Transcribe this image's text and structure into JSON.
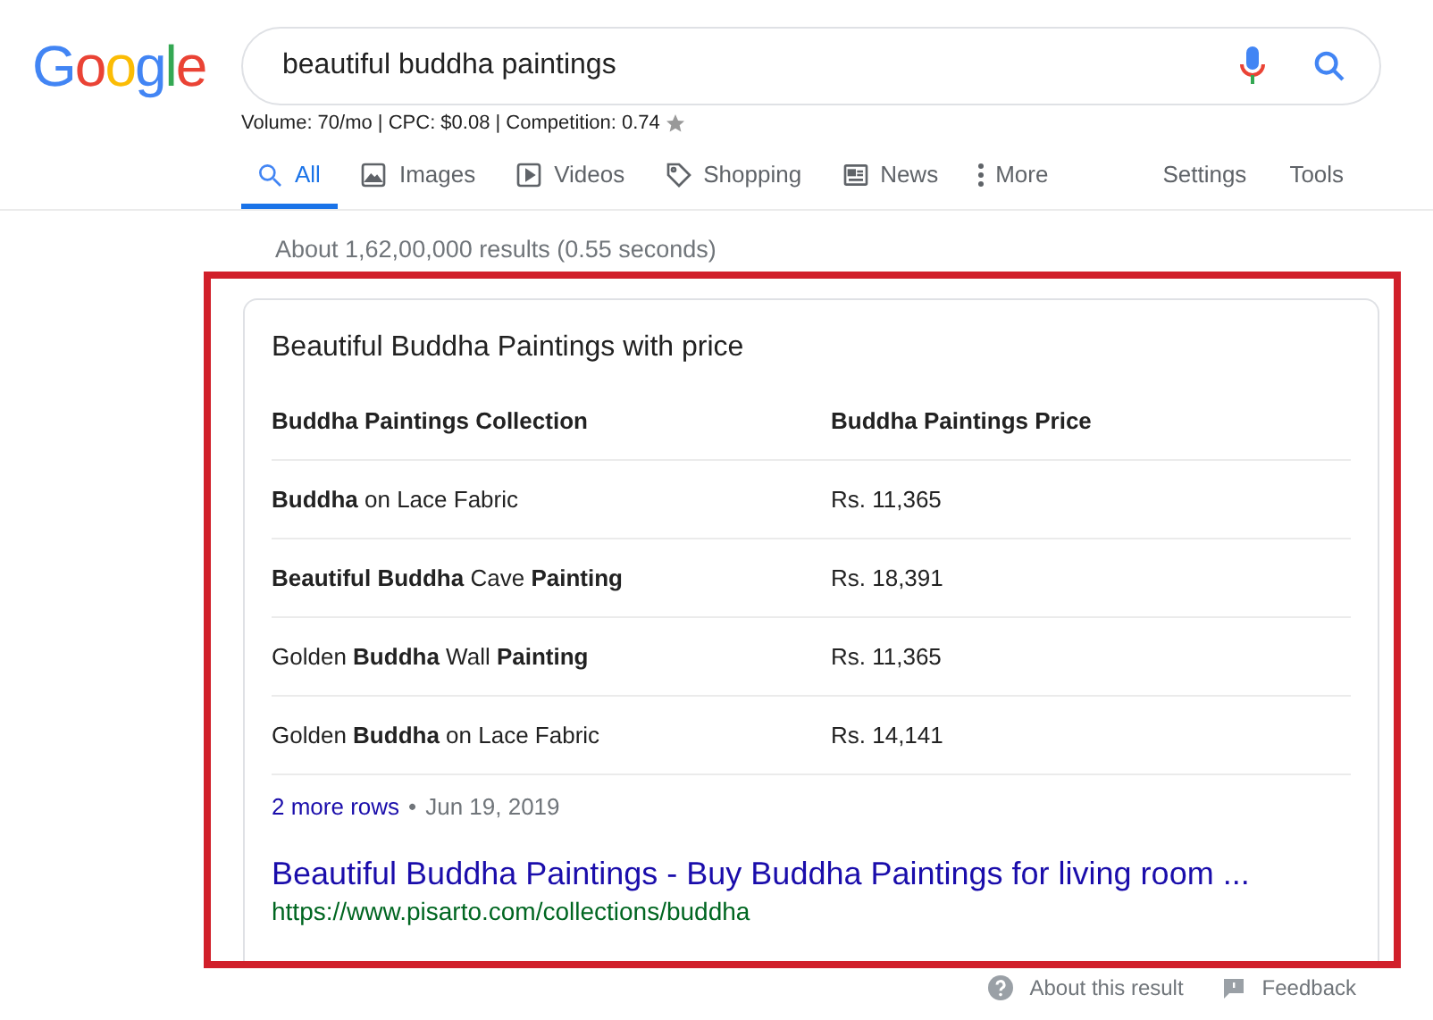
{
  "logo": "Google",
  "search": {
    "value": "beautiful buddha paintings"
  },
  "keyword_stats": "Volume: 70/mo | CPC: $0.08 | Competition: 0.74",
  "tabs": [
    {
      "label": "All",
      "kind": "search",
      "selected": true
    },
    {
      "label": "Images",
      "kind": "image",
      "selected": false
    },
    {
      "label": "Videos",
      "kind": "video",
      "selected": false
    },
    {
      "label": "Shopping",
      "kind": "tag",
      "selected": false
    },
    {
      "label": "News",
      "kind": "news",
      "selected": false
    },
    {
      "label": "More",
      "kind": "more",
      "selected": false
    }
  ],
  "tools": [
    "Settings",
    "Tools"
  ],
  "result_stats": "About 1,62,00,000 results (0.55 seconds)",
  "snippet": {
    "title": "Beautiful Buddha Paintings with price",
    "table": {
      "columns": [
        "Buddha Paintings Collection",
        "Buddha Paintings Price"
      ],
      "rows": [
        [
          "**Buddha** on Lace Fabric",
          "Rs. 11,365"
        ],
        [
          "**Beautiful Buddha** Cave **Painting**",
          "Rs. 18,391"
        ],
        [
          "Golden **Buddha** Wall **Painting**",
          "Rs. 11,365"
        ],
        [
          "Golden **Buddha** on Lace Fabric",
          "Rs. 14,141"
        ]
      ]
    },
    "more_rows": "2 more rows",
    "separator": "•",
    "date": "Jun 19, 2019",
    "link_title": "Beautiful Buddha Paintings - Buy Buddha Paintings for living room ...",
    "url": "https://www.pisarto.com/collections/buddha"
  },
  "footer": [
    "About this result",
    "Feedback"
  ]
}
